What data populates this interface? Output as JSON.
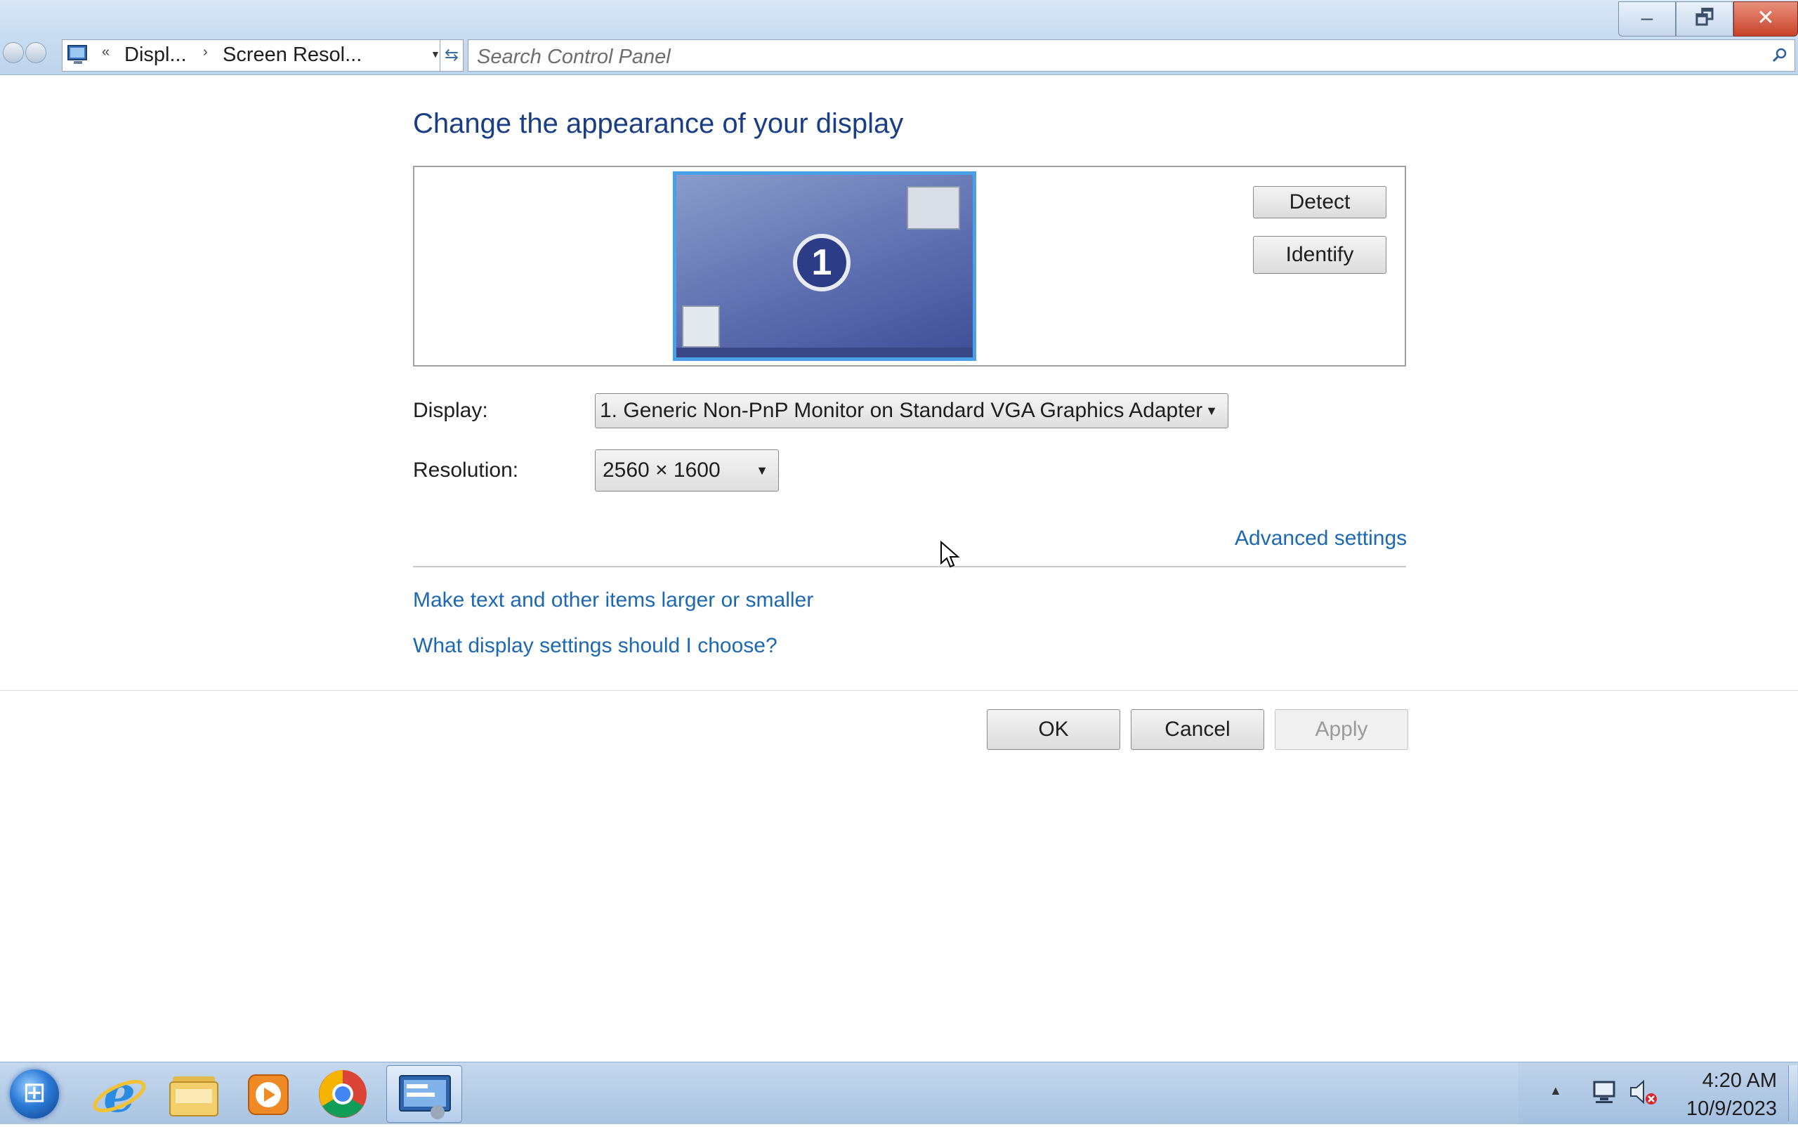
{
  "window": {
    "minimize_glyph": "–",
    "maximize_glyph": "🗗",
    "close_glyph": "✕"
  },
  "nav": {
    "breadcrumb_overflow": "«",
    "breadcrumb": [
      "Displ...",
      "Screen Resol..."
    ],
    "separator": "›",
    "search_placeholder": "Search Control Panel"
  },
  "page": {
    "heading": "Change the appearance of your display",
    "monitor_number": "1",
    "detect_label": "Detect",
    "identify_label": "Identify",
    "display_label": "Display:",
    "display_value": "1. Generic Non-PnP Monitor on Standard VGA Graphics Adapter",
    "resolution_label": "Resolution:",
    "resolution_value": "2560 × 1600",
    "advanced_link": "Advanced settings",
    "text_size_link": "Make text and other items larger or smaller",
    "help_link": "What display settings should I choose?"
  },
  "buttons": {
    "ok": "OK",
    "cancel": "Cancel",
    "apply": "Apply"
  },
  "taskbar": {
    "apps": [
      "internet-explorer-icon",
      "windows-explorer-icon",
      "media-player-icon",
      "chrome-icon",
      "control-panel-icon"
    ],
    "time": "4:20 AM",
    "date": "10/9/2023"
  },
  "colors": {
    "link": "#1c68b3",
    "heading": "#193e85",
    "monitor_tile": "#5d6fb0",
    "selection_border": "#4aa0e6"
  }
}
